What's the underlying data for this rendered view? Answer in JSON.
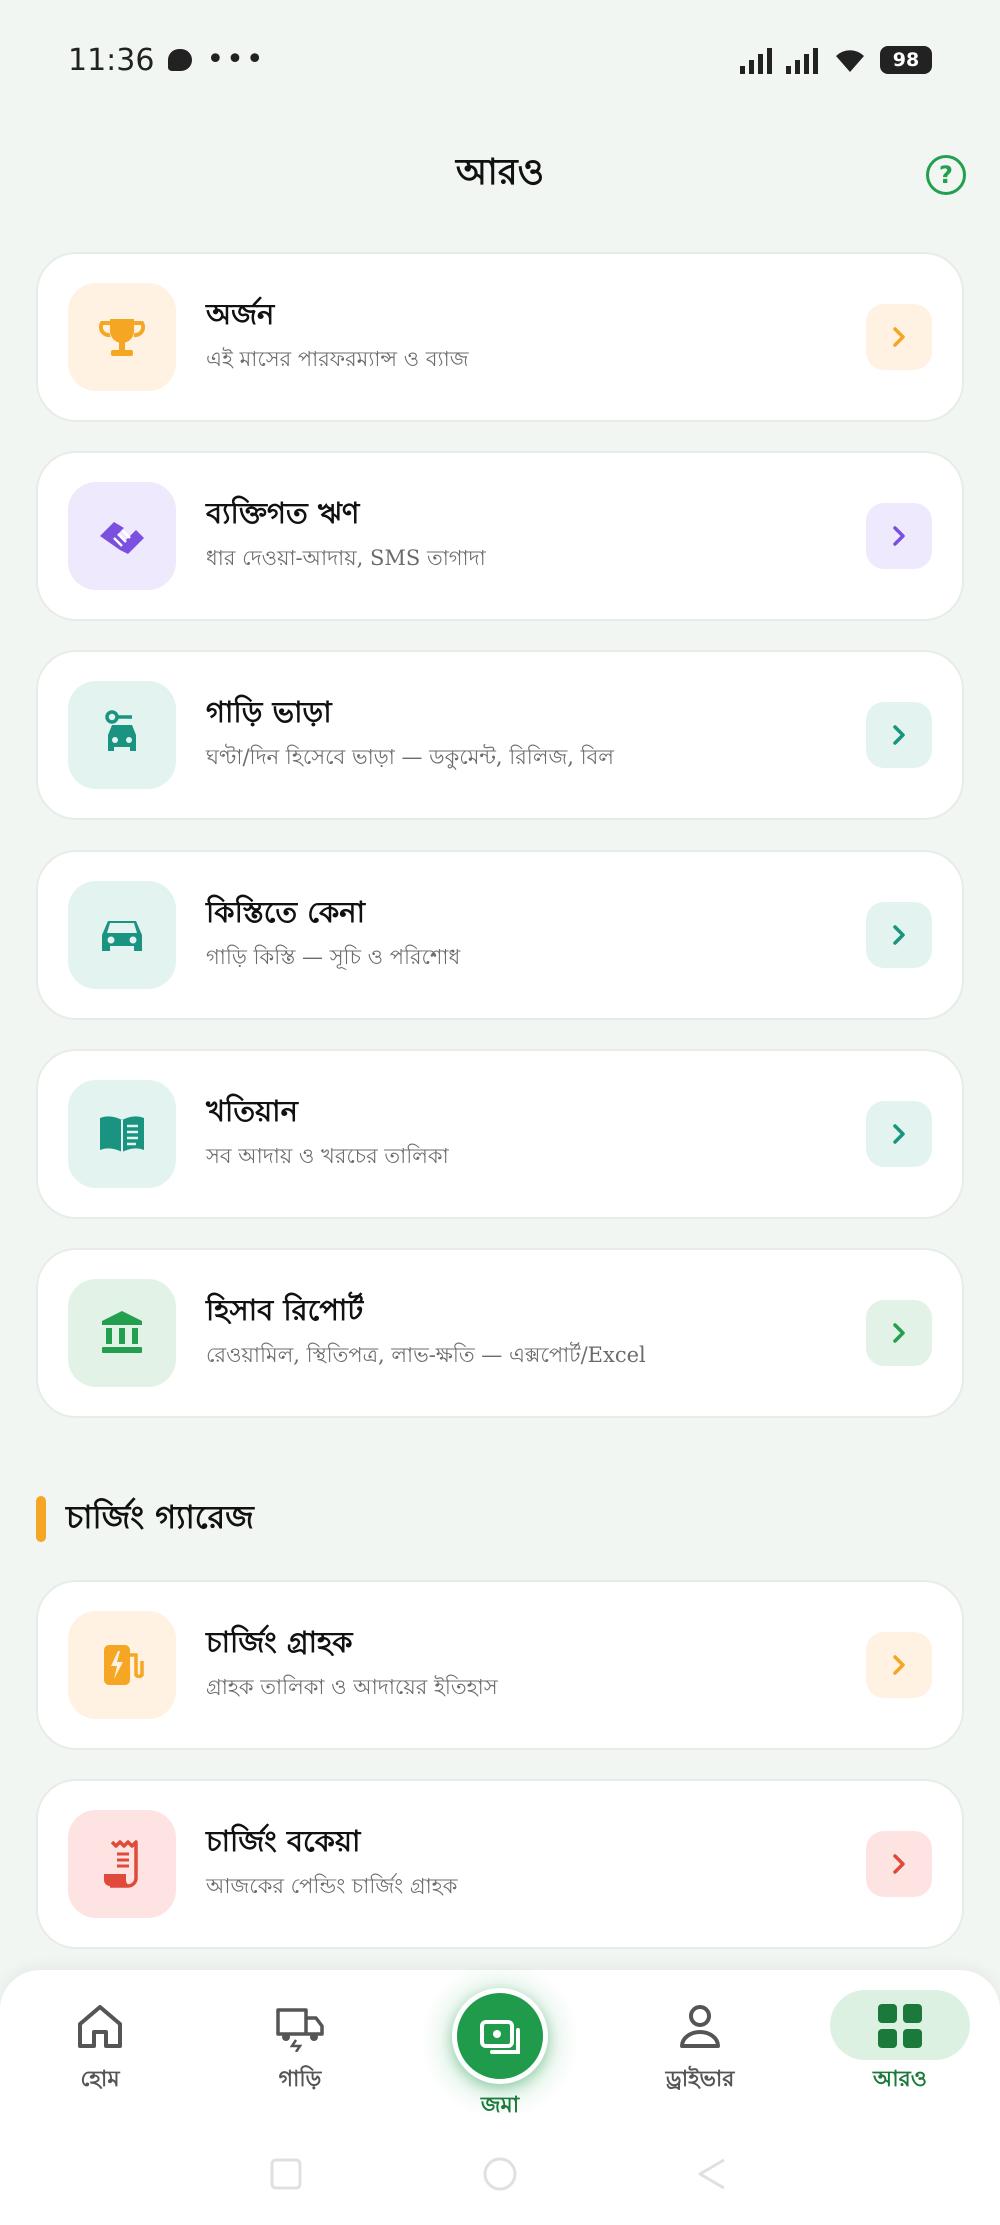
{
  "status_bar": {
    "time": "11:36",
    "dots": "•••",
    "battery": "98"
  },
  "header": {
    "title": "আরও",
    "help_icon": "question-circle-icon"
  },
  "colors": {
    "primary_green": "#1f9b4b",
    "orange": "#f5a623",
    "purple": "#7b4fe0",
    "teal": "#1a9480",
    "green": "#22a04f",
    "red": "#e04a3a"
  },
  "menu": [
    {
      "id": "earnings",
      "title": "অর্জন",
      "subtitle": "এই মাসের পারফরম্যান্স ও ব্যাজ",
      "icon": "trophy-icon"
    },
    {
      "id": "personal-loan",
      "title": "ব্যক্তিগত ঋণ",
      "subtitle": "ধার দেওয়া-আদায়, SMS তাগাদা",
      "icon": "handshake-icon"
    },
    {
      "id": "car-rent",
      "title": "গাড়ি ভাড়া",
      "subtitle": "ঘণ্টা/দিন হিসেবে ভাড়া — ডকুমেন্ট, রিলিজ, বিল",
      "icon": "car-key-icon"
    },
    {
      "id": "installment",
      "title": "কিস্তিতে কেনা",
      "subtitle": "গাড়ি কিস্তি — সূচি ও পরিশোধ",
      "icon": "car-icon"
    },
    {
      "id": "ledger",
      "title": "খতিয়ান",
      "subtitle": "সব আদায় ও খরচের তালিকা",
      "icon": "book-icon"
    },
    {
      "id": "accounts-report",
      "title": "হিসাব রিপোর্ট",
      "subtitle": "রেওয়ামিল, স্থিতিপত্র, লাভ-ক্ষতি — এক্সপোর্ট/Excel",
      "icon": "bank-icon"
    }
  ],
  "section": {
    "title": "চার্জিং গ্যারেজ"
  },
  "charging_menu": [
    {
      "id": "charging-customers",
      "title": "চার্জিং গ্রাহক",
      "subtitle": "গ্রাহক তালিকা ও আদায়ের ইতিহাস",
      "icon": "ev-charger-icon"
    },
    {
      "id": "charging-dues",
      "title": "চার্জিং বকেয়া",
      "subtitle": "আজকের পেন্ডিং চার্জিং গ্রাহক",
      "icon": "receipt-icon"
    }
  ],
  "bottom_nav": {
    "home": "হোম",
    "vehicles": "গাড়ি",
    "deposit": "জমা",
    "driver": "ড্রাইভার",
    "more": "আরও",
    "active": "more"
  }
}
